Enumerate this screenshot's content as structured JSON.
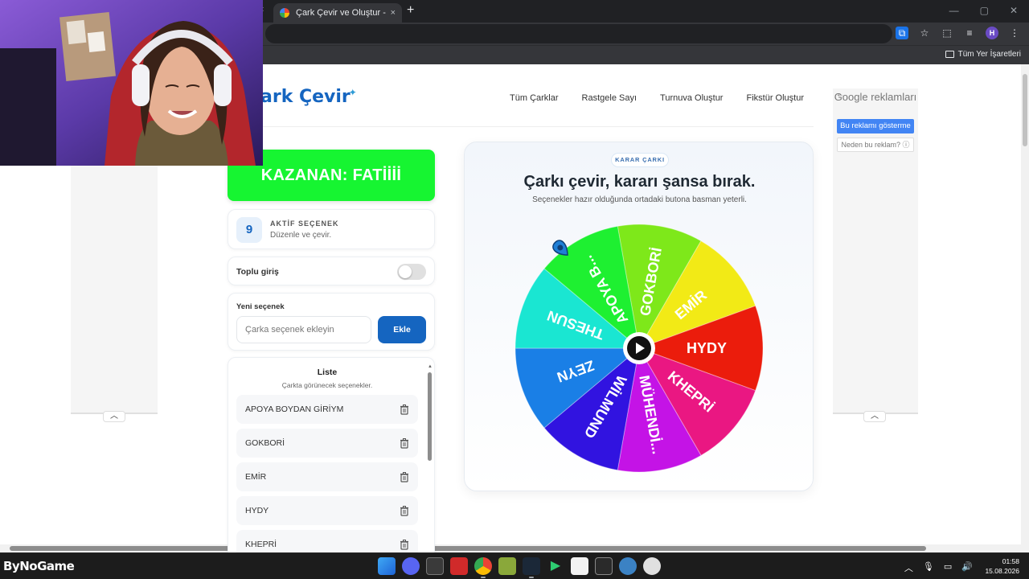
{
  "browser": {
    "active_tab_title": "Çark Çevir ve Oluştur - Ücretsiz",
    "tab_close": "×",
    "new_tab": "+",
    "bookmarks_all": "Tüm Yer İşaretleri",
    "profile_initial": "H"
  },
  "site": {
    "logo": "ark Çevir",
    "nav": [
      "Tüm Çarklar",
      "Rastgele Sayı",
      "Turnuva Oluştur",
      "Fikstür Oluştur"
    ]
  },
  "ads": {
    "google_title": "Google reklamları",
    "show_button": "Bu reklamı gösterme",
    "why_button": "Neden bu reklam? ⓘ"
  },
  "panel": {
    "winner_text": "KAZANAN: FATİİİİ",
    "winner_color": "#16f531",
    "active_count": "9",
    "active_title": "AKTİF SEÇENEK",
    "active_sub": "Düzenle ve çevir.",
    "bulk_label": "Toplu giriş",
    "bulk_on": false,
    "new_label": "Yeni seçenek",
    "new_placeholder": "Çarka seçenek ekleyin",
    "new_value": "",
    "add_button": "Ekle",
    "list_title": "Liste",
    "list_sub": "Çarkta görünecek seçenekler.",
    "items": [
      "APOYA BOYDAN GİRİYM",
      "GOKBORİ",
      "EMİR",
      "HYDY",
      "KHEPRİ"
    ]
  },
  "wheel": {
    "pill": "KARAR ÇARKI",
    "title": "Çarkı çevir, kararı şansa bırak.",
    "subtitle": "Seçenekler hazır olduğunda ortadaki butona basman yeterli.",
    "segments": [
      {
        "label": "GOKBORİ",
        "color": "#7ee81a"
      },
      {
        "label": "EMİR",
        "color": "#f2ea16"
      },
      {
        "label": "HYDY",
        "color": "#eb1c0c"
      },
      {
        "label": "KHEPRİ",
        "color": "#ea1782"
      },
      {
        "label": "MÜHENDİ...",
        "color": "#c413e6"
      },
      {
        "label": "WİLMUND",
        "color": "#3113e0"
      },
      {
        "label": "ZEYN",
        "color": "#1a7fe6"
      },
      {
        "label": "THESUN",
        "color": "#1ae6d2"
      },
      {
        "label": "APOYA B...",
        "color": "#1ef031"
      }
    ]
  },
  "taskbar": {
    "brand": "ByNoGame",
    "time": "01:58",
    "date": "15.08.2026"
  }
}
